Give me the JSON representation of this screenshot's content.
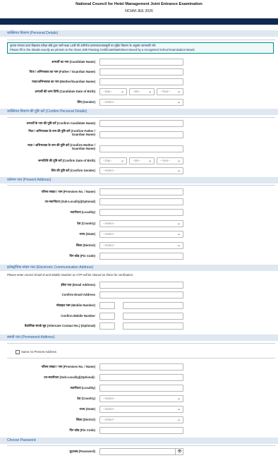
{
  "header": {
    "title": "National Council for Hotel Management Joint Entrance Examination",
    "subtitle": "NCHM-JEE 2026"
  },
  "sections": {
    "personal": "व्यक्तिगत विवरण (Personal Details)",
    "confirm": "व्यक्तिगत विवरण की पुष्टि करें (Confirm Personal Details)",
    "present": "वर्तमान पता (Present Address)",
    "electronic": "इलेक्ट्रॉनिक संचार पता (Electronic Communication Address)",
    "permanent": "स्थायी पता (Permanent Address)",
    "password": "Choose Password"
  },
  "note": {
    "hindi": "कृपया मान्यता प्राप्त विद्यालय परीक्षा बोर्ड द्वारा जारी कक्षा 10वीं की उत्तीर्णता प्रमाणपत्र/अंकसूची पर मुद्रित विवरण के अनुसार जानकारी भरें।",
    "english": "Please fill in the details exactly as printed on the Class 10th Passing Certificate/Marksheet issued by a recognized School Examination Board."
  },
  "personal": {
    "name": "अभ्यर्थी का नाम (Candidate Name)",
    "father": "पिता / अभिभावक का नाम (Father / Guardian Name)",
    "mother": "माता/अभिभावक का नाम (Mother/Guardian Name)",
    "dob": "अभ्यर्थी की जन्म तिथि (Candidate Date of Birth)",
    "gender": "लिंग (Gender)",
    "day": "--Day--",
    "mo": "--Mo--",
    "year": "--Year--",
    "select": "--Select--"
  },
  "confirm": {
    "name": "अभ्यर्थी के नाम की पुष्टि करें (Confirm Candidate Name)",
    "father": "पिता / अभिभावक के नाम की पुष्टि करें (Confirm Father / Guardian Name)",
    "mother": "माता / अभिभावक के नाम की पुष्टि करें (Confirm Mother / Guardian Name)",
    "dob": "जन्मतिथि की पुष्टि करें (Confirm Date of Birth)",
    "gender": "लिंग की पुष्टि करें (Confirm Gender)",
    "day": "--Day--",
    "mo": "--Mo--",
    "year": "--Year--",
    "select": "--Select--"
  },
  "present": {
    "premises": "परिसर संख्या / नाम (Premises No. / Name)",
    "sublocality": "उप-स्थानीयता (Sub-Locality)(Optional)",
    "locality": "स्थानीयता (Locality)",
    "country": "देश (Country)",
    "state": "राज्य (State)",
    "district": "जिला (District)",
    "pincode": "पिन कोड (Pin Code)",
    "select": "--Select--"
  },
  "electronic": {
    "info": "Please enter correct Email Id and Mobile Number as OTP will be shared on these for verification.",
    "email": "ईमेल पता (Email Address)",
    "confirm_email": "Confirm Email Address",
    "mobile": "मोबाइल नंबर (Mobile Number)",
    "confirm_mobile": "Confirm Mobile Number",
    "alternate": "वैकल्पिक संपर्क सूत्र (Alternate Contact No.) (Optional)"
  },
  "permanent": {
    "same": "Same As Present Address",
    "premises": "परिसर संख्या / नाम (Premises No. / Name)",
    "sublocality": "उप-स्थानीयता (Sub-Locality)(Optional):",
    "locality": "स्थानीयता (Locality)",
    "country": "देश (Country)",
    "state": "राज्य (State)",
    "district": "जिला (District)",
    "pincode": "पिन कोड (Pin Code)",
    "select": "--Select--"
  },
  "password": {
    "label": "कूटशब्द (Password)"
  }
}
